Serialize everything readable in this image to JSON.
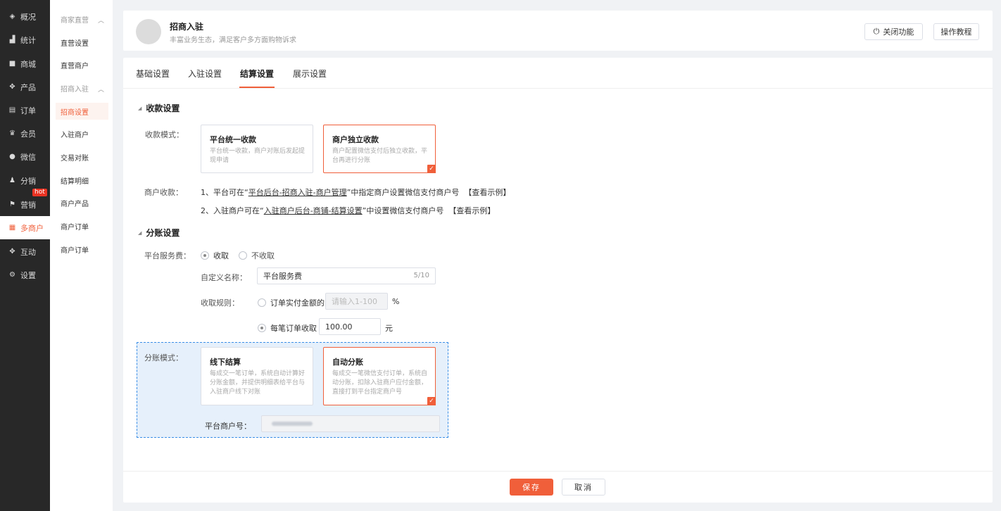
{
  "nav": {
    "items": [
      {
        "label": "概况",
        "icon": "layers-icon"
      },
      {
        "label": "统计",
        "icon": "chart-icon"
      },
      {
        "label": "商城",
        "icon": "store-icon"
      },
      {
        "label": "产品",
        "icon": "product-icon"
      },
      {
        "label": "订单",
        "icon": "order-icon"
      },
      {
        "label": "会员",
        "icon": "crown-icon"
      },
      {
        "label": "微信",
        "icon": "wechat-icon"
      },
      {
        "label": "分销",
        "icon": "distribution-icon"
      },
      {
        "label": "营销",
        "icon": "flag-icon",
        "badge": "hot"
      },
      {
        "label": "多商户",
        "icon": "merchant-icon"
      },
      {
        "label": "互动",
        "icon": "grid-icon"
      },
      {
        "label": "设置",
        "icon": "gear-icon"
      }
    ],
    "active": "多商户"
  },
  "submenu": {
    "group1": "商家直营",
    "direct_settings": "直营设置",
    "direct_merchants": "直营商户",
    "group2": "招商入驻",
    "recruit_settings": "招商设置",
    "settled_merchants": "入驻商户",
    "reconciliation": "交易对账",
    "settlement_detail": "结算明细",
    "merchant_products": "商户产品",
    "merchant_orders_1": "商户订单",
    "merchant_orders_2": "商户订单"
  },
  "header": {
    "title": "招商入驻",
    "subtitle": "丰富业务生态，满足客户多方面购物诉求",
    "close_feature": "关闭功能",
    "tutorial": "操作教程"
  },
  "tabs": [
    "基础设置",
    "入驻设置",
    "结算设置",
    "展示设置"
  ],
  "active_tab": "结算设置",
  "collection": {
    "section_title": "收款设置",
    "mode_label": "收款模式：",
    "options": [
      {
        "title": "平台统一收款",
        "desc": "平台统一收款，商户对账后发起提现申请",
        "selected": false
      },
      {
        "title": "商户独立收款",
        "desc": "商户配置微信支付后独立收款，平台再进行分账",
        "selected": true
      }
    ],
    "merchant_label": "商户收款：",
    "line1_pre": "1、平台可在“",
    "line1_link": "平台后台-招商入驻-商户管理",
    "line1_post": "”中指定商户设置微信支付商户号",
    "line1_example": "【查看示例】",
    "line2_pre": "2、入驻商户可在“",
    "line2_link": "入驻商户后台-商铺-结算设置",
    "line2_post": "”中设置微信支付商户号",
    "line2_example": "【查看示例】"
  },
  "split": {
    "section_title": "分账设置",
    "fee_label": "平台服务费：",
    "fee_on": "收取",
    "fee_off": "不收取",
    "name_label": "自定义名称：",
    "name_value": "平台服务费",
    "name_count": "5/10",
    "rule_label": "收取规则：",
    "rule_percent": "订单实付金额的",
    "rule_percent_placeholder": "请输入1-100",
    "percent_unit": "%",
    "rule_fixed": "每笔订单收取",
    "fixed_value": "100.00",
    "yuan_unit": "元",
    "mode_label": "分账模式：",
    "modes": [
      {
        "title": "线下结算",
        "desc": "每成交一笔订单，系统自动计算好分账金额，并提供明细表给平台与入驻商户线下对账",
        "selected": false
      },
      {
        "title": "自动分账",
        "desc": "每成交一笔微信支付订单，系统自动分账，扣除入驻商户应付金额，直接打到平台指定商户号",
        "selected": true
      }
    ],
    "merchant_no_label": "平台商户号："
  },
  "footer": {
    "save": "保存",
    "cancel": "取消"
  },
  "colors": {
    "accent": "#f05f3a",
    "nav_bg": "#282828",
    "highlight_bg": "#e6f0fb"
  }
}
